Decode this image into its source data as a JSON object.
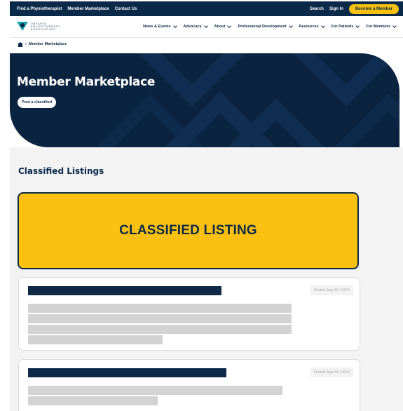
{
  "utility": {
    "links": [
      "Find a Physiotherapist",
      "Member Marketplace",
      "Contact Us"
    ],
    "search": "Search",
    "sign_in": "Sign In",
    "become_member": "Become a Member"
  },
  "logo": {
    "text": "ONTARIO PHYSIOTHERAPY ASSOCIATION"
  },
  "nav": {
    "items": [
      "News & Events",
      "Advocacy",
      "About",
      "Professional Development",
      "Resources",
      "For Patients",
      "For Members"
    ]
  },
  "breadcrumb": {
    "current": "Member Marketplace"
  },
  "hero": {
    "title": "Member Marketplace",
    "button": "Post a classified"
  },
  "section": {
    "title": "Classified Listings"
  },
  "featured": {
    "label": "CLASSIFIED LISTING"
  },
  "listings": [
    {
      "posted": "Posted: Aug XX, XXXX"
    },
    {
      "posted": "Posted: Aug XX, XXXX"
    }
  ],
  "colors": {
    "navy": "#0b2a4a",
    "accent_yellow": "#fbc010",
    "teal": "#17a2a8"
  }
}
